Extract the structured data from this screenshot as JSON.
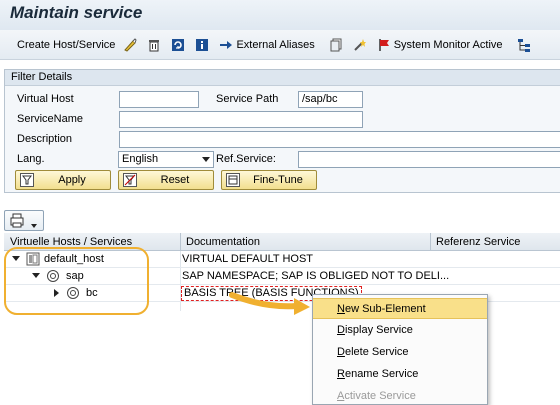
{
  "window": {
    "title": "Maintain service"
  },
  "toolbar": {
    "create_label": "Create Host/Service",
    "external_aliases_label": "External Aliases",
    "system_monitor_label": "System Monitor Active"
  },
  "filter": {
    "header": "Filter Details",
    "virtual_host_label": "Virtual Host",
    "virtual_host_value": "",
    "service_path_label": "Service Path",
    "service_path_value": "/sap/bc",
    "service_name_label": "ServiceName",
    "service_name_value": "",
    "description_label": "Description",
    "description_value": "",
    "lang_label": "Lang.",
    "lang_value": "English",
    "ref_service_label": "Ref.Service:",
    "ref_service_value": "",
    "apply_label": "Apply",
    "reset_label": "Reset",
    "finetune_label": "Fine-Tune"
  },
  "grid": {
    "columns": [
      "Virtuelle Hosts / Services",
      "Documentation",
      "Referenz Service"
    ],
    "rows": [
      {
        "name": "default_host",
        "doc": "VIRTUAL DEFAULT HOST"
      },
      {
        "name": "sap",
        "doc": "SAP NAMESPACE; SAP IS OBLIGED NOT TO DELI..."
      },
      {
        "name": "bc",
        "doc": "BASIS TREE (BASIS FUNCTIONS)"
      }
    ]
  },
  "context_menu": {
    "items": [
      {
        "label": "New Sub-Element",
        "u": "N",
        "rest": "ew Sub-Element"
      },
      {
        "label": "Display Service",
        "u": "D",
        "rest": "isplay Service"
      },
      {
        "label": "Delete Service",
        "u": "D",
        "rest": "elete Service"
      },
      {
        "label": "Rename Service",
        "u": "R",
        "rest": "ename Service"
      },
      {
        "label": "Activate Service",
        "u": "A",
        "rest": "ctivate Service"
      }
    ]
  },
  "colors": {
    "highlight": "#f9e08a",
    "annotation": "#f0b030",
    "selected_cell": "#e02020"
  },
  "icons": [
    "glasses-icon",
    "trash-icon",
    "refresh-icon",
    "info-icon",
    "arrow-right-icon",
    "copy-icon",
    "wand-icon",
    "flag-icon",
    "hierarchy-icon",
    "filter-icon",
    "reset-icon",
    "finetune-icon",
    "print-icon",
    "folder-icon",
    "service-icon"
  ]
}
